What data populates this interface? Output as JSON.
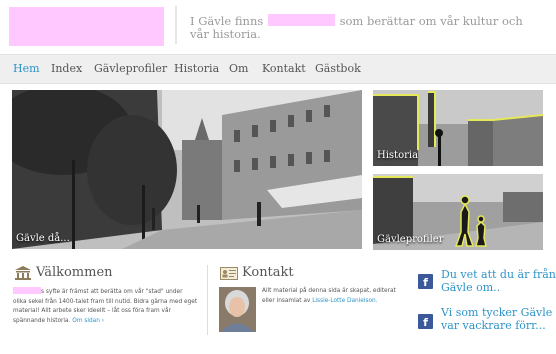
{
  "header": {
    "tagline_before": "I Gävle finns",
    "tagline_after": "som berättar om vår kultur och vår historia."
  },
  "nav": {
    "items": [
      {
        "label": "Hem",
        "active": true
      },
      {
        "label": "Index",
        "active": false
      },
      {
        "label": "Gävleprofiler",
        "active": false
      },
      {
        "label": "Historia",
        "active": false
      },
      {
        "label": "Om",
        "active": false
      },
      {
        "label": "Kontakt",
        "active": false
      },
      {
        "label": "Gästbok",
        "active": false
      }
    ]
  },
  "photos": {
    "main_caption": "Gävle då...",
    "historia_caption": "Historia",
    "profiler_caption": "Gävleprofiler"
  },
  "welcome": {
    "title": "Välkommen",
    "text_1": "s syfte är främst att berätta om vår \"stad\" under",
    "text_2": "olika sekel från 1400-talet fram till nutid. Bidra gärna med eget",
    "text_3": "material! Allt arbete sker ideellt – låt oss föra fram vår",
    "text_4": "spännande historia.",
    "link": "Om sidan ›"
  },
  "contact": {
    "title": "Kontakt",
    "text_1": "Allt material på denna sida är skapat, editerat",
    "text_2": "eller insamlat av",
    "author_link": "Lissie-Lotte Danielson."
  },
  "facebook": {
    "post_1": "Du vet att du är från Gävle om..",
    "post_2": "Vi som tycker Gävle var vackrare förr..."
  },
  "colors": {
    "accent": "#2e94c9",
    "pink_highlight": "#ffc9ff",
    "nav_background": "#efefef"
  }
}
